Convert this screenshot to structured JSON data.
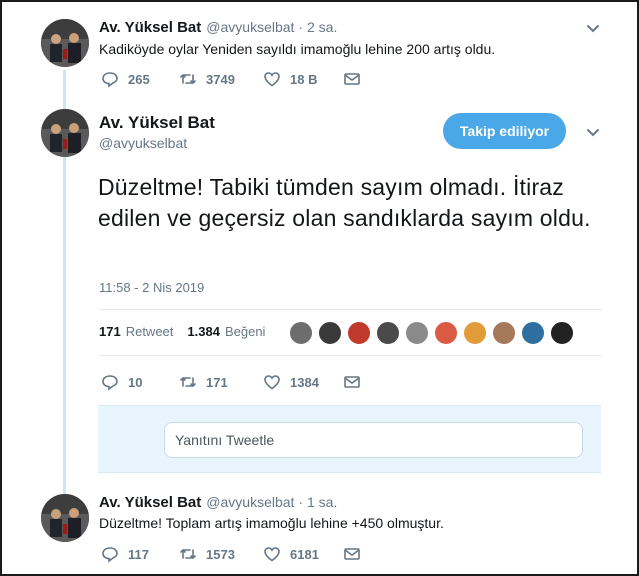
{
  "thread": {
    "tweet1": {
      "name": "Av. Yüksel Bat",
      "handle": "@avyukselbat",
      "time": "· 2 sa.",
      "text": "Kadiköyde oylar Yeniden sayıldı imamoğlu lehine 200 artış oldu.",
      "replies": "265",
      "retweets": "3749",
      "likes": "18 B"
    },
    "main": {
      "name": "Av. Yüksel Bat",
      "handle": "@avyukselbat",
      "follow_label": "Takip ediliyor",
      "text": "Düzeltme! Tabiki tümden sayım olmadı. İtiraz edilen ve geçersiz olan sandıklarda sayım oldu.",
      "date": "11:58 - 2 Nis 2019",
      "retweet_count": "171",
      "retweet_label": "Retweet",
      "like_count": "1.384",
      "like_label": "Beğeni",
      "replies": "10",
      "retweets": "171",
      "likes": "1384",
      "reply_placeholder": "Yanıtını Tweetle"
    },
    "tweet3": {
      "name": "Av. Yüksel Bat",
      "handle": "@avyukselbat",
      "time": "· 1 sa.",
      "text": "Düzeltme! Toplam artış imamoğlu lehine +450 olmuştur.",
      "replies": "117",
      "retweets": "1573",
      "likes": "6181"
    }
  },
  "icons": {
    "reply": "reply-icon",
    "retweet": "retweet-icon",
    "like": "heart-icon",
    "dm": "envelope-icon",
    "more": "chevron-down-icon"
  },
  "colors": {
    "accent": "#4aa8e8",
    "thread_line": "#cce4f7",
    "muted": "#657786"
  }
}
